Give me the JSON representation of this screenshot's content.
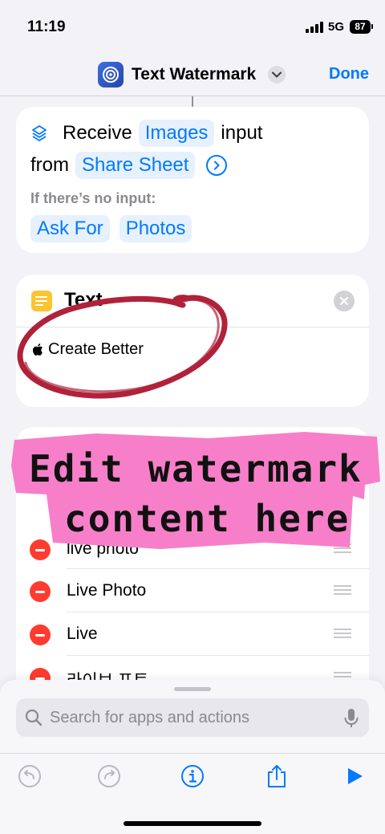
{
  "status": {
    "time": "11:19",
    "network": "5G",
    "battery": "87"
  },
  "nav": {
    "title": "Text Watermark",
    "done_label": "Done"
  },
  "receive": {
    "prefix": "Receive",
    "input_type": "Images",
    "suffix": "input",
    "from_label": "from",
    "source": "Share Sheet",
    "no_input_label": "If there’s no input:",
    "fallback_action": "Ask For",
    "fallback_type": "Photos"
  },
  "text_action": {
    "title": "Text",
    "content": "Create Better"
  },
  "list": {
    "items": [
      {
        "label": "live photo"
      },
      {
        "label": "Live Photo"
      },
      {
        "label": "Live"
      },
      {
        "label": "라이브 포토"
      }
    ]
  },
  "annotation": {
    "line1": "Edit watermark",
    "line2": "content here"
  },
  "search": {
    "placeholder": "Search for apps and actions"
  },
  "colors": {
    "accent": "#007aff",
    "destructive": "#ff3b30",
    "highlight": "#f77fc9",
    "scribble": "#b0223a"
  }
}
